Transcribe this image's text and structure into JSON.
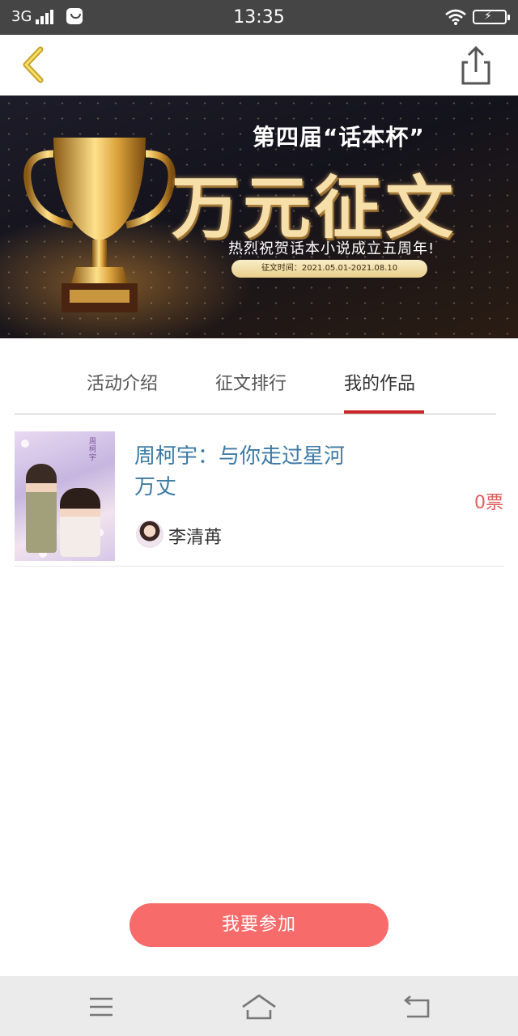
{
  "status_bar": {
    "network": "3G",
    "time": "13:35"
  },
  "banner": {
    "sub_title": "第四届“话本杯”",
    "main_title": "万元征文",
    "slogan": "热烈祝贺话本小说成立五周年!",
    "date_range": "征文时间：2021.05.01-2021.08.10"
  },
  "tabs": [
    {
      "label": "活动介绍",
      "active": false
    },
    {
      "label": "征文排行",
      "active": false
    },
    {
      "label": "我的作品",
      "active": true
    }
  ],
  "works": [
    {
      "title": "周柯宇：与你走过星河万丈",
      "cover_text": "周柯宇",
      "author": "李清苒",
      "votes": "0票"
    }
  ],
  "join_button": {
    "label": "我要参加"
  },
  "colors": {
    "accent_red": "#c9262c",
    "button_red": "#f76b6b",
    "title_blue": "#3c7aa6",
    "vote_red": "#e05c5c",
    "status_bar_bg": "#454545"
  }
}
